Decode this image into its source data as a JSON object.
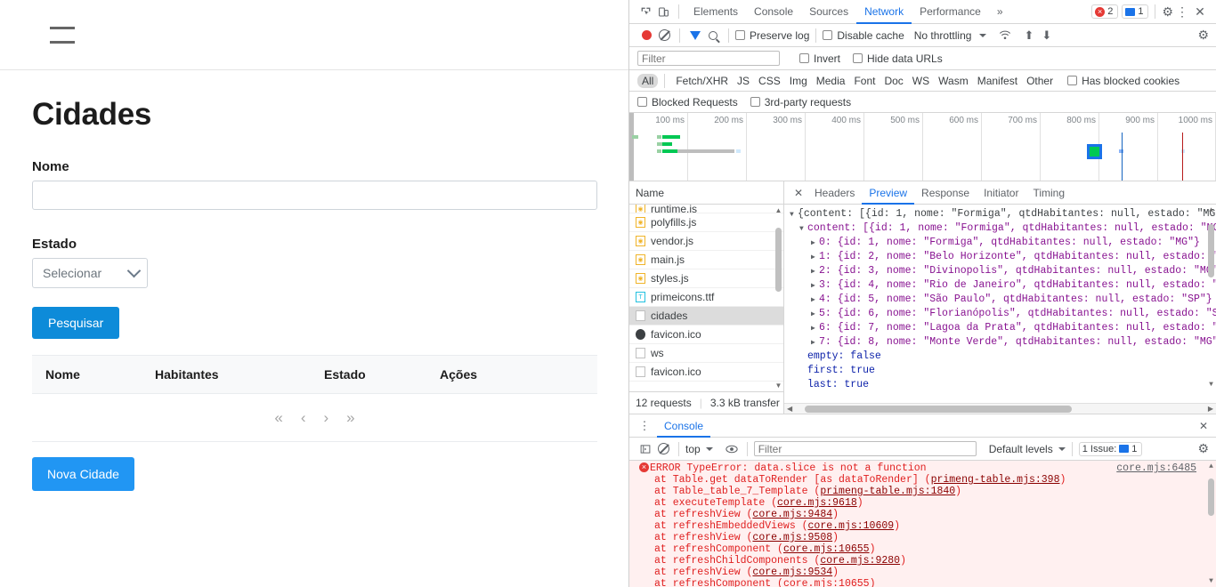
{
  "app": {
    "menu_icon": "hamburger-icon",
    "title": "Cidades",
    "form": {
      "nome_label": "Nome",
      "nome_value": "",
      "nome_placeholder": "",
      "estado_label": "Estado",
      "estado_selected": "Selecionar",
      "search_button": "Pesquisar"
    },
    "table": {
      "columns": [
        "Nome",
        "Habitantes",
        "Estado",
        "Ações"
      ],
      "rows": [],
      "paginator": [
        "«",
        "‹",
        "›",
        "»"
      ]
    },
    "new_button": "Nova Cidade",
    "colors": {
      "search_blue": "#0d8bd9",
      "new_blue": "#2196f3"
    }
  },
  "devtools": {
    "left_icons": [
      "inspect-element-icon",
      "device-toolbar-icon"
    ],
    "tabs": [
      {
        "label": "Elements",
        "selected": false
      },
      {
        "label": "Console",
        "selected": false
      },
      {
        "label": "Sources",
        "selected": false
      },
      {
        "label": "Network",
        "selected": true
      },
      {
        "label": "Performance",
        "selected": false
      }
    ],
    "more_tabs": "»",
    "error_count": "2",
    "message_count": "1",
    "right_icons": [
      "settings-gear-icon",
      "more-options-icon",
      "close-icon"
    ],
    "network_toolbar": {
      "record": "record-button",
      "clear": "clear-button",
      "filter_icon": "filter-icon",
      "search_icon": "search-icon",
      "preserve_log": "Preserve log",
      "disable_cache": "Disable cache",
      "throttling": "No throttling",
      "wifi_icon": "network-conditions-icon",
      "import_icon": "import-har-icon",
      "export_icon": "export-har-icon",
      "settings_icon": "settings-gear-icon"
    },
    "filter_bar": {
      "placeholder": "Filter",
      "value": "",
      "invert": "Invert",
      "hide_data_urls": "Hide data URLs"
    },
    "resource_types": [
      "All",
      "Fetch/XHR",
      "JS",
      "CSS",
      "Img",
      "Media",
      "Font",
      "Doc",
      "WS",
      "Wasm",
      "Manifest",
      "Other"
    ],
    "selected_type": "All",
    "has_blocked_cookies": "Has blocked cookies",
    "blocked_requests": "Blocked Requests",
    "third_party_requests": "3rd-party requests",
    "overview": {
      "ticks": [
        "100 ms",
        "200 ms",
        "300 ms",
        "400 ms",
        "500 ms",
        "600 ms",
        "700 ms",
        "800 ms",
        "900 ms",
        "1000 ms"
      ]
    },
    "request_list": {
      "header": "Name",
      "rows": [
        {
          "name": "runtime.js",
          "icon": "js-file-icon",
          "selected": false,
          "partial": true
        },
        {
          "name": "polyfills.js",
          "icon": "js-file-icon",
          "selected": false
        },
        {
          "name": "vendor.js",
          "icon": "js-file-icon",
          "selected": false
        },
        {
          "name": "main.js",
          "icon": "js-file-icon",
          "selected": false
        },
        {
          "name": "styles.js",
          "icon": "js-file-icon",
          "selected": false
        },
        {
          "name": "primeicons.ttf",
          "icon": "font-file-icon",
          "selected": false
        },
        {
          "name": "cidades",
          "icon": "generic-file-icon",
          "selected": true
        },
        {
          "name": "favicon.ico",
          "icon": "favicon-icon",
          "selected": false
        },
        {
          "name": "ws",
          "icon": "generic-file-icon",
          "selected": false
        },
        {
          "name": "favicon.ico",
          "icon": "generic-file-icon",
          "selected": false
        }
      ],
      "footer_requests": "12 requests",
      "footer_transfer": "3.3 kB transfer"
    },
    "detail": {
      "close_icon": "close-icon",
      "tabs": [
        {
          "label": "Headers",
          "selected": false
        },
        {
          "label": "Preview",
          "selected": true
        },
        {
          "label": "Response",
          "selected": false
        },
        {
          "label": "Initiator",
          "selected": false
        },
        {
          "label": "Timing",
          "selected": false
        }
      ],
      "preview_lines": [
        "{content: [{id: 1, nome: \"Formiga\", qtdHabitantes: null, estado: \"MG\"",
        "content: [{id: 1, nome: \"Formiga\", qtdHabitantes: null, estado: \"MG",
        "0: {id: 1, nome: \"Formiga\", qtdHabitantes: null, estado: \"MG\"}",
        "1: {id: 2, nome: \"Belo Horizonte\", qtdHabitantes: null, estado: \"",
        "2: {id: 3, nome: \"Divinopolis\", qtdHabitantes: null, estado: \"MG\"",
        "3: {id: 4, nome: \"Rio de Janeiro\", qtdHabitantes: null, estado: \"",
        "4: {id: 5, nome: \"São Paulo\", qtdHabitantes: null, estado: \"SP\"}",
        "5: {id: 6, nome: \"Florianópolis\", qtdHabitantes: null, estado: \"S",
        "6: {id: 7, nome: \"Lagoa da Prata\", qtdHabitantes: null, estado: \"",
        "7: {id: 8, nome: \"Monte Verde\", qtdHabitantes: null, estado: \"MG\"",
        "empty: false",
        "first: true",
        "last: true"
      ]
    },
    "console": {
      "tab": "Console",
      "close_icon": "close-icon",
      "sidebar_icon": "console-sidebar-icon",
      "clear_icon": "clear-console-icon",
      "context": "top",
      "eye_icon": "live-expression-icon",
      "filter_placeholder": "Filter",
      "filter_value": "",
      "levels": "Default levels",
      "issues": "1 Issue:",
      "issues_count": "1",
      "settings_icon": "settings-gear-icon",
      "error_headline": "ERROR TypeError: data.slice is not a function",
      "error_source": "core.mjs:6485",
      "stack": [
        {
          "text": "at Table.get dataToRender [as dataToRender] (",
          "link": "primeng-table.mjs:398",
          "tail": ")"
        },
        {
          "text": "at Table_table_7_Template (",
          "link": "primeng-table.mjs:1840",
          "tail": ")"
        },
        {
          "text": "at executeTemplate (",
          "link": "core.mjs:9618",
          "tail": ")"
        },
        {
          "text": "at refreshView (",
          "link": "core.mjs:9484",
          "tail": ")"
        },
        {
          "text": "at refreshEmbeddedViews (",
          "link": "core.mjs:10609",
          "tail": ")"
        },
        {
          "text": "at refreshView (",
          "link": "core.mjs:9508",
          "tail": ")"
        },
        {
          "text": "at refreshComponent (",
          "link": "core.mjs:10655",
          "tail": ")"
        },
        {
          "text": "at refreshChildComponents (",
          "link": "core.mjs:9280",
          "tail": ")"
        },
        {
          "text": "at refreshView (",
          "link": "core.mjs:9534",
          "tail": ")"
        },
        {
          "text": "at refreshComponent (",
          "link": "core.mjs:10655",
          "tail": ")"
        }
      ]
    }
  }
}
